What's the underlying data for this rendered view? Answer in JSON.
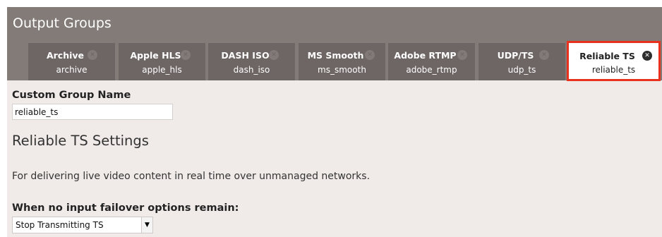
{
  "header": {
    "title": "Output Groups"
  },
  "tabs": [
    {
      "name": "Archive",
      "id": "archive"
    },
    {
      "name": "Apple HLS",
      "id": "apple_hls"
    },
    {
      "name": "DASH ISO",
      "id": "dash_iso"
    },
    {
      "name": "MS Smooth",
      "id": "ms_smooth"
    },
    {
      "name": "Adobe RTMP",
      "id": "adobe_rtmp"
    },
    {
      "name": "UDP/TS",
      "id": "udp_ts"
    },
    {
      "name": "Reliable TS",
      "id": "reliable_ts"
    }
  ],
  "active_tab_index": 6,
  "close_icon": "close-icon",
  "custom_group": {
    "label": "Custom Group Name",
    "value": "reliable_ts"
  },
  "settings": {
    "title": "Reliable TS Settings",
    "description": "For delivering live video content in real time over unmanaged networks."
  },
  "failover": {
    "label": "When no input failover options remain:",
    "selected": "Stop Transmitting TS"
  },
  "colors": {
    "header_bg": "#837b78",
    "tab_bg": "#6e6664",
    "active_border": "#e8321d",
    "panel_bg": "#f0ebe9"
  }
}
